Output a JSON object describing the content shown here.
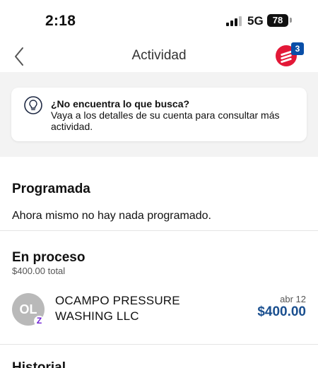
{
  "status_bar": {
    "time": "2:18",
    "network": "5G",
    "battery": "78"
  },
  "nav": {
    "title": "Actividad",
    "menu_badge": "3",
    "brand_color": "#e31837",
    "badge_color": "#0a4fa8",
    "back_icon": "chevron-left-icon",
    "menu_icon": "menu-icon"
  },
  "tip": {
    "icon": "lightbulb-icon",
    "title": "¿No encuentra lo que busca?",
    "body": "Vaya a los detalles de su cuenta para consultar más actividad."
  },
  "scheduled": {
    "title": "Programada",
    "empty_message": "Ahora mismo no hay nada programado."
  },
  "in_progress": {
    "title": "En proceso",
    "total": "$400.00 total",
    "transactions": [
      {
        "initials": "OL",
        "payment_method_icon": "zelle-icon",
        "payment_method_glyph": "Z",
        "merchant": "OCAMPO PRESSURE WASHING LLC",
        "date": "abr 12",
        "amount": "$400.00"
      }
    ]
  },
  "history": {
    "title": "Historial"
  },
  "colors": {
    "amount": "#1a4f8f",
    "zelle": "#6d1ed4"
  }
}
